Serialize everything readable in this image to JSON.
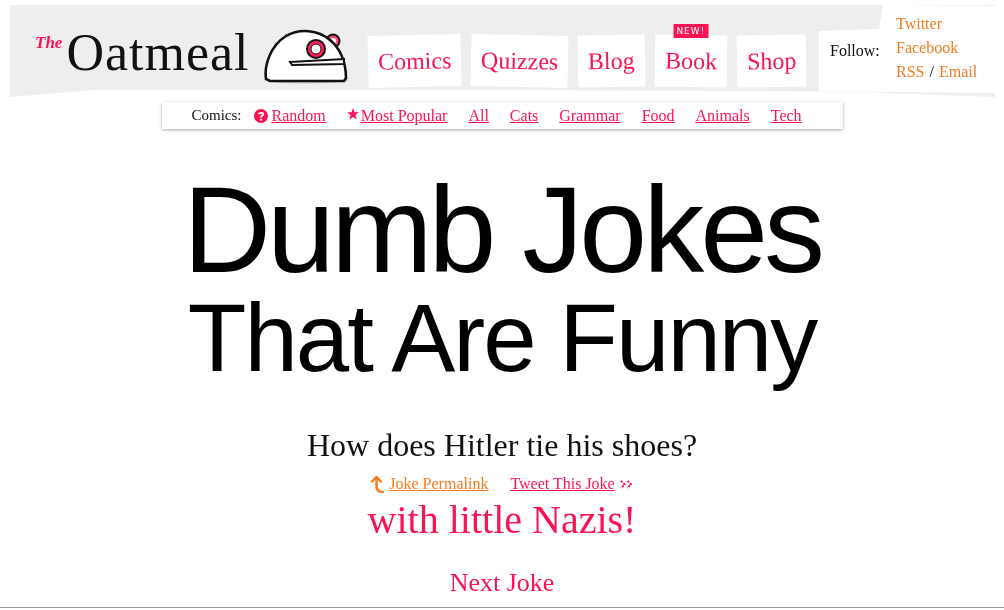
{
  "header": {
    "logo": {
      "prefix": "The",
      "name": "Oatmeal"
    },
    "nav": [
      {
        "label": "Comics"
      },
      {
        "label": "Quizzes"
      },
      {
        "label": "Blog"
      },
      {
        "label": "Book",
        "badge": "NEW!"
      },
      {
        "label": "Shop"
      }
    ],
    "follow": {
      "label": "Follow:",
      "rows": [
        {
          "links": [
            "Twitter"
          ]
        },
        {
          "links": [
            "Facebook"
          ]
        },
        {
          "links": [
            "RSS",
            "Email"
          ],
          "separator": "/"
        }
      ]
    }
  },
  "subnav": {
    "label": "Comics:",
    "links": [
      {
        "kind": "random",
        "label": "Random"
      },
      {
        "kind": "popular",
        "label": "Most Popular"
      },
      {
        "kind": "category",
        "label": "All"
      },
      {
        "kind": "category",
        "label": "Cats"
      },
      {
        "kind": "category",
        "label": "Grammar"
      },
      {
        "kind": "category",
        "label": "Food"
      },
      {
        "kind": "category",
        "label": "Animals"
      },
      {
        "kind": "category",
        "label": "Tech"
      }
    ]
  },
  "title": {
    "lines": [
      "Dumb Jokes",
      "That Are Funny"
    ]
  },
  "joke": {
    "question": "How does Hitler tie his shoes?",
    "links": [
      {
        "kind": "permalink",
        "label": "Joke Permalink"
      },
      {
        "kind": "tweet",
        "label": "Tweet This Joke"
      }
    ],
    "answer": "with little Nazis!",
    "next": "Next Joke"
  }
}
